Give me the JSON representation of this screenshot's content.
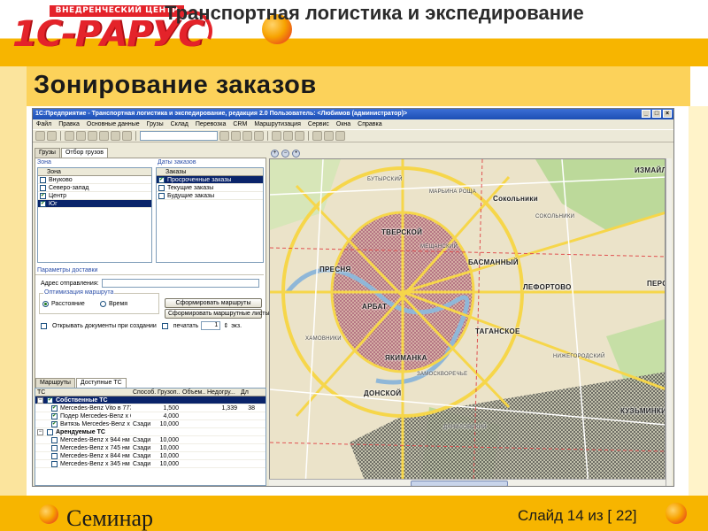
{
  "slide": {
    "header_title": "Транспортная логистика и экспедирование",
    "page_title": "Зонирование заказов",
    "footer_left": "Семинар",
    "footer_right": "Слайд 14 из [ 22]"
  },
  "logo": {
    "banner": "ВНЕДРЕНЧЕСКИЙ ЦЕНТР",
    "text": "1С-РАРУС"
  },
  "app": {
    "title": "1С:Предприятие - Транспортная логистика и экспедирование, редакция 2.0   Пользователь: <Любимов (администратор)>",
    "menu": [
      "Файл",
      "Правка",
      "Основные данные",
      "Грузы",
      "Склад",
      "Перевозка",
      "CRM",
      "Маршрутизация",
      "Сервис",
      "Окна",
      "Справка"
    ],
    "left_tabs": [
      "Грузы",
      "Отбор грузов"
    ],
    "zones": {
      "group_label": "Зона",
      "header": "Зона",
      "rows": [
        {
          "label": "Внуково",
          "checked": false,
          "selected": false
        },
        {
          "label": "Северо-запад",
          "checked": false,
          "selected": false
        },
        {
          "label": "Центр",
          "checked": true,
          "selected": false
        },
        {
          "label": "Юг",
          "checked": true,
          "selected": true
        }
      ]
    },
    "order_dates": {
      "group_label": "Даты заказов",
      "header": "Заказы",
      "rows": [
        {
          "label": "Просроченные заказы",
          "checked": true,
          "selected": true
        },
        {
          "label": "Текущие заказы",
          "checked": false,
          "selected": false
        },
        {
          "label": "Будущие заказы",
          "checked": false,
          "selected": false
        }
      ]
    },
    "delivery": {
      "group_label": "Параметры доставки",
      "address_label": "Адрес отправления:",
      "route_group": "Оптимизация маршрута",
      "radio_distance": "Расстояние",
      "radio_time": "Время",
      "btn_form_routes": "Сформировать маршруты",
      "btn_form_sheets": "Сформировать маршрутные листы",
      "open_docs_label": "Открывать документы при создании",
      "print_label": "печатать",
      "copies_value": "1",
      "copies_unit": "экз."
    },
    "bottom_tabs": [
      "Маршруты",
      "Доступные ТС"
    ],
    "tc_table": {
      "headers": [
        "ТС",
        "Способ...",
        "Грузоп...",
        "Объем...",
        "Недогру...",
        "Дл"
      ],
      "rows": [
        {
          "level": 0,
          "expander": "−",
          "checked": true,
          "name": "Собственные ТС",
          "c1": "",
          "c2": "",
          "c3": "",
          "c4": "",
          "c5": "",
          "selected": true
        },
        {
          "level": 1,
          "expander": "",
          "checked": true,
          "name": "Mercedes-Benz Vito в 777 в...",
          "c1": "",
          "c2": "1,500",
          "c3": "",
          "c4": "1,339",
          "c5": "38",
          "selected": false
        },
        {
          "level": 1,
          "expander": "",
          "checked": true,
          "name": "Подер Mercedes-Benz х 67...",
          "c1": "",
          "c2": "4,000",
          "c3": "",
          "c4": "",
          "c5": "",
          "selected": false
        },
        {
          "level": 1,
          "expander": "",
          "checked": true,
          "name": "Витязь Mercedes-Benz х 3...",
          "c1": "Сзади",
          "c2": "10,000",
          "c3": "",
          "c4": "",
          "c5": "",
          "selected": false
        },
        {
          "level": 0,
          "expander": "−",
          "checked": false,
          "name": "Арендуемые ТС",
          "c1": "",
          "c2": "",
          "c3": "",
          "c4": "",
          "c5": "",
          "selected": false
        },
        {
          "level": 1,
          "expander": "",
          "checked": false,
          "name": "Mercedes-Benz х 944 нм 50",
          "c1": "Сзади",
          "c2": "10,000",
          "c3": "",
          "c4": "",
          "c5": "",
          "selected": false
        },
        {
          "level": 1,
          "expander": "",
          "checked": false,
          "name": "Mercedes-Benz х 745 нм 45",
          "c1": "Сзади",
          "c2": "10,000",
          "c3": "",
          "c4": "",
          "c5": "",
          "selected": false
        },
        {
          "level": 1,
          "expander": "",
          "checked": false,
          "name": "Mercedes-Benz х 844 нм 90",
          "c1": "Сзади",
          "c2": "10,000",
          "c3": "",
          "c4": "",
          "c5": "",
          "selected": false
        },
        {
          "level": 1,
          "expander": "",
          "checked": false,
          "name": "Mercedes-Benz х 345 нм 67",
          "c1": "Сзади",
          "c2": "10,000",
          "c3": "",
          "c4": "",
          "c5": "",
          "selected": false
        }
      ]
    },
    "map": {
      "labels": [
        "ИЗМАЙЛ",
        "Сокольники",
        "ТВЕРСКОЙ",
        "ПРЕСНЯ",
        "БАСМАННЫЙ",
        "ЛЕФОРТОВО",
        "ПЕРОВ",
        "АРБАТ",
        "ТАГАНСКОЕ",
        "ЯКИМАНКА",
        "ДОНСКОЙ",
        "КУЗЬМИНКИ"
      ],
      "small_labels": [
        "БУТЫРСКИЙ",
        "МАРЬИНА РОЩА",
        "СОКОЛЬНИКИ",
        "МЕЩАНСКИЙ",
        "ЗАМОСКВОРЕЧЬЕ",
        "ХАМОВНИКИ",
        "ДАНИЛОВСКИЙ",
        "НИЖЕГОРОДСКИЙ"
      ]
    }
  },
  "colors": {
    "accent_yellow": "#f7b500",
    "brand_red": "#e4232a",
    "selection": "#0a246a",
    "zone_center": "#b54a7a",
    "zone_south": "#3a3a3a"
  }
}
